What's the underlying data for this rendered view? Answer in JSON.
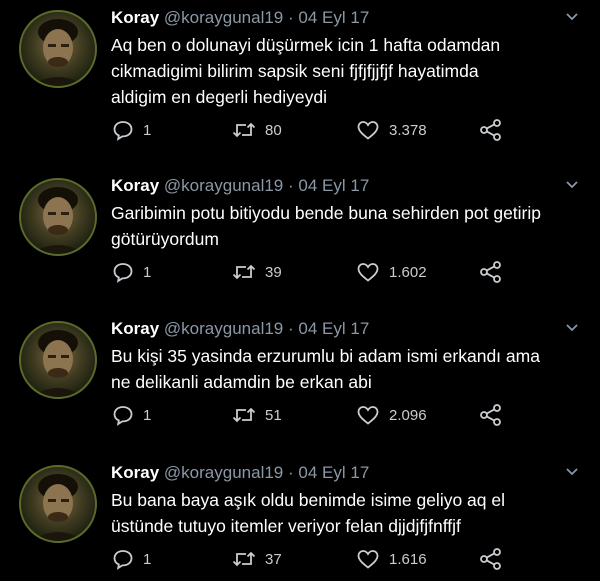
{
  "tweets": [
    {
      "name": "Koray",
      "handle": "@koraygunal19",
      "separator": "·",
      "date": "04 Eyl 17",
      "lines": [
        "Aq ben o dolunayi düşürmek icin 1 hafta odamdan",
        "cikmadigimi bilirim sapsik seni fjfjfjjfjf hayatimda",
        "aldigim en degerli hediyeydi"
      ],
      "replies": "1",
      "retweets": "80",
      "likes": "3.378"
    },
    {
      "name": "Koray",
      "handle": "@koraygunal19",
      "separator": "·",
      "date": "04 Eyl 17",
      "lines": [
        "Garibimin potu bitiyodu bende buna sehirden pot getirip",
        "götürüyordum"
      ],
      "replies": "1",
      "retweets": "39",
      "likes": "1.602"
    },
    {
      "name": "Koray",
      "handle": "@koraygunal19",
      "separator": "·",
      "date": "04 Eyl 17",
      "lines": [
        "Bu kişi 35 yasinda erzurumlu bi adam ismi erkandı ama",
        "ne delikanli adamdin be erkan abi"
      ],
      "replies": "1",
      "retweets": "51",
      "likes": "2.096"
    },
    {
      "name": "Koray",
      "handle": "@koraygunal19",
      "separator": "·",
      "date": "04 Eyl 17",
      "lines": [
        "Bu bana baya aşık oldu benimde isime geliyo aq el",
        "üstünde tutuyo itemler veriyor felan djjdjfjfnffjf"
      ],
      "replies": "1",
      "retweets": "37",
      "likes": "1.616"
    }
  ],
  "icons": {
    "reply": "reply-icon",
    "retweet": "retweet-icon",
    "like": "heart-icon",
    "share": "share-icon",
    "menu": "chevron-down-icon",
    "avatar": "avatar"
  },
  "colors": {
    "background": "#000000",
    "text": "#ffffff",
    "secondary": "#8b98a5"
  }
}
